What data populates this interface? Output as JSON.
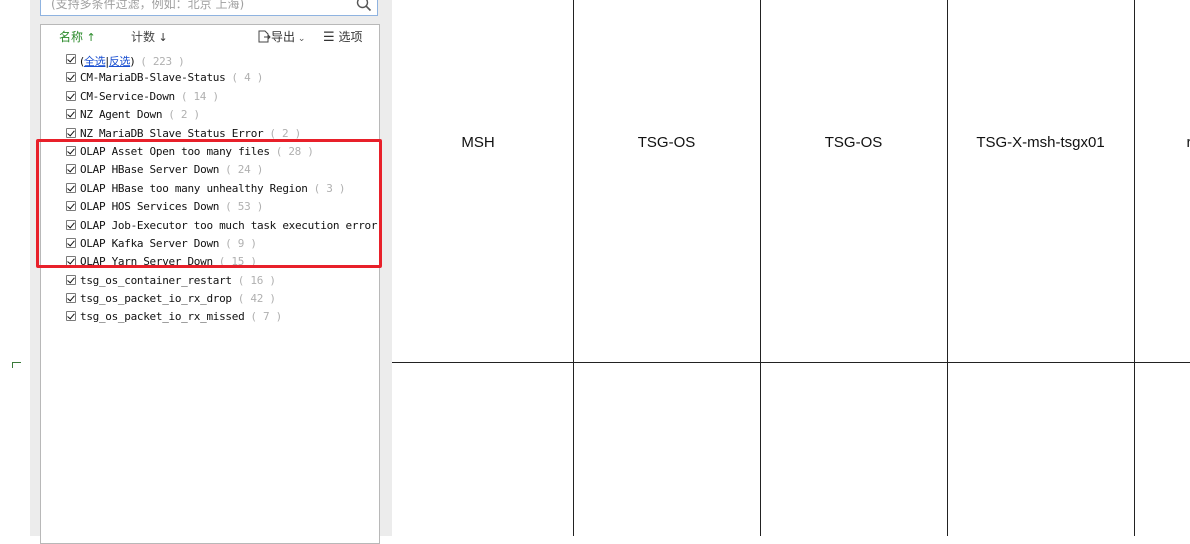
{
  "filter": {
    "search_placeholder": "(支持多条件过滤，例如：北京 上海)",
    "toolbar": {
      "name_label": "名称",
      "count_label": "计数",
      "export_label": "导出",
      "options_label": "选项"
    },
    "select_all": {
      "all": "全选",
      "invert": "反选",
      "count": "( 223 )"
    },
    "items": [
      {
        "label": "CM-MariaDB-Slave-Status",
        "count": "( 4 )"
      },
      {
        "label": "CM-Service-Down",
        "count": "( 14 )"
      },
      {
        "label": "NZ Agent Down",
        "count": "( 2 )"
      },
      {
        "label": "NZ MariaDB Slave Status Error",
        "count": "( 2 )"
      },
      {
        "label": "OLAP Asset Open too many files",
        "count": "( 28 )"
      },
      {
        "label": "OLAP HBase Server Down",
        "count": "( 24 )"
      },
      {
        "label": "OLAP HBase too many unhealthy Region",
        "count": "( 3 )"
      },
      {
        "label": "OLAP HOS Services Down",
        "count": "( 53 )"
      },
      {
        "label": "OLAP Job-Executor too much task execution error",
        "count": ""
      },
      {
        "label": "OLAP Kafka Server Down",
        "count": "( 9 )"
      },
      {
        "label": "OLAP Yarn Server Down",
        "count": "( 15 )"
      },
      {
        "label": "tsg_os_container_restart",
        "count": "( 16 )"
      },
      {
        "label": "tsg_os_packet_io_rx_drop",
        "count": "( 42 )"
      },
      {
        "label": "tsg_os_packet_io_rx_missed",
        "count": "( 7 )"
      }
    ]
  },
  "sheet": {
    "cells": [
      "MSH",
      "TSG-OS",
      "TSG-OS",
      "TSG-X-msh-tsgx01"
    ]
  },
  "colors": {
    "highlight": "#e8202a",
    "link": "#1a4fd1",
    "sort_active": "#2a8a2a"
  }
}
